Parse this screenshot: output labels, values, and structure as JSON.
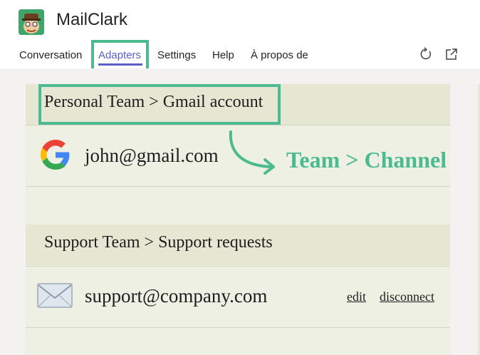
{
  "app": {
    "title": "MailClark"
  },
  "nav": {
    "tabs": [
      {
        "label": "Conversation"
      },
      {
        "label": "Adapters"
      },
      {
        "label": "Settings"
      },
      {
        "label": "Help"
      },
      {
        "label": "À propos de"
      }
    ],
    "active_tab": "Adapters",
    "actions": [
      "refresh-icon",
      "popout-icon"
    ]
  },
  "adapters": [
    {
      "header": "Personal Team > Gmail account",
      "account": "john@gmail.com",
      "icon": "google-icon"
    },
    {
      "header": "Support Team > Support requests",
      "account": "support@company.com",
      "icon": "envelope-icon",
      "actions": {
        "edit": "edit",
        "disconnect": "disconnect"
      }
    }
  ],
  "annotation": {
    "text": "Team > Channel"
  },
  "colors": {
    "accent": "#5b5fc7",
    "highlight": "#4bbb8f",
    "panel": "#eff0e4",
    "section_header": "#e6e7d2"
  }
}
